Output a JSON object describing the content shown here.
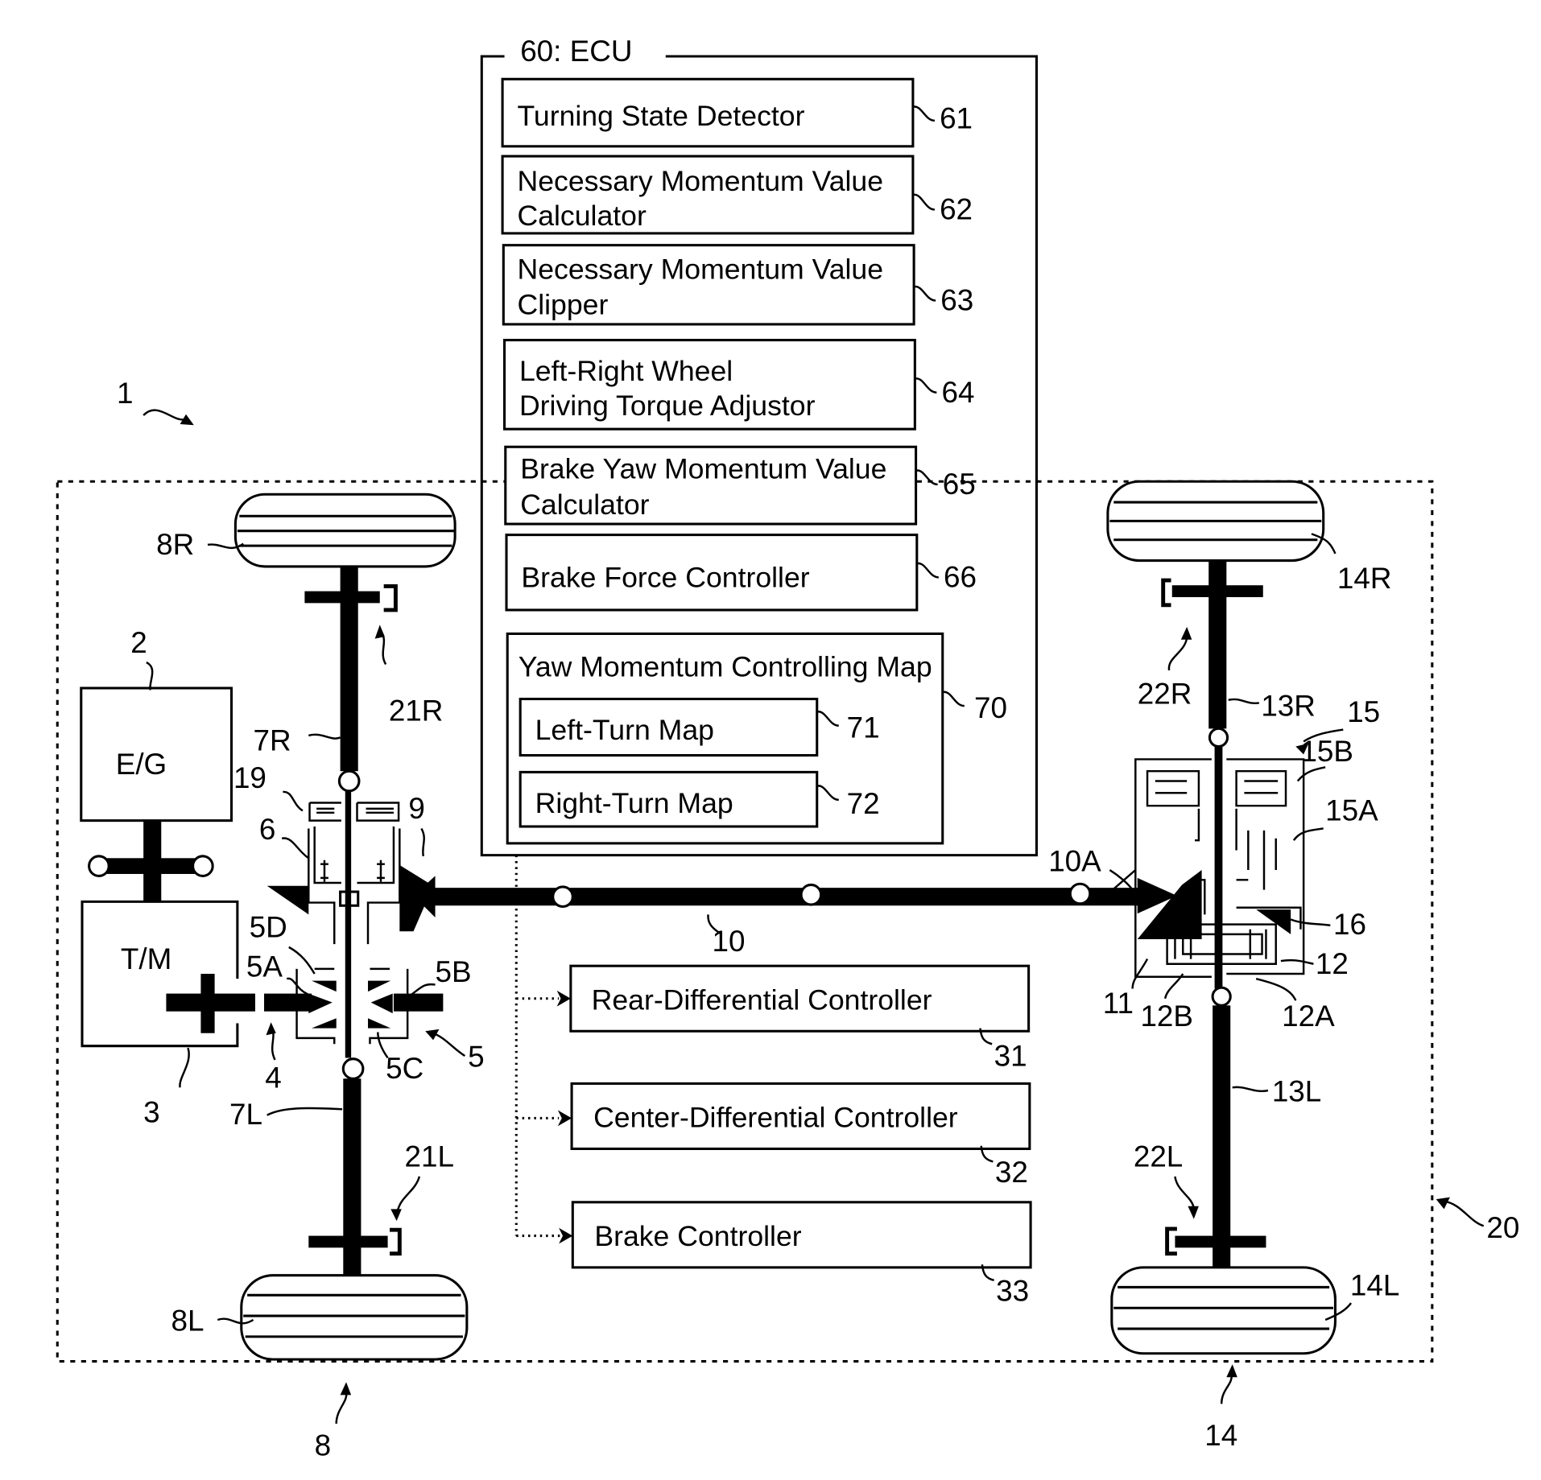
{
  "figure": {
    "system_label": "1",
    "vehicle_frame_label": "20"
  },
  "ecu": {
    "title": "60: ECU",
    "modules": [
      {
        "ref": "61",
        "lines": [
          "Turning State Detector"
        ]
      },
      {
        "ref": "62",
        "lines": [
          "Necessary Momentum Value",
          "Calculator"
        ]
      },
      {
        "ref": "63",
        "lines": [
          "Necessary Momentum Value",
          "Clipper"
        ]
      },
      {
        "ref": "64",
        "lines": [
          "Left-Right Wheel",
          "Driving Torque Adjustor"
        ]
      },
      {
        "ref": "65",
        "lines": [
          "Brake Yaw Momentum Value",
          "Calculator"
        ]
      },
      {
        "ref": "66",
        "lines": [
          "Brake Force Controller"
        ]
      }
    ],
    "map": {
      "ref": "70",
      "title": "Yaw Momentum Controlling Map",
      "submaps": [
        {
          "ref": "71",
          "label": "Left-Turn Map"
        },
        {
          "ref": "72",
          "label": "Right-Turn Map"
        }
      ]
    }
  },
  "controllers": [
    {
      "ref": "31",
      "label": "Rear-Differential Controller"
    },
    {
      "ref": "32",
      "label": "Center-Differential Controller"
    },
    {
      "ref": "33",
      "label": "Brake Controller"
    }
  ],
  "drivetrain": {
    "engine": {
      "ref": "2",
      "label": "E/G"
    },
    "transmission": {
      "ref": "3",
      "label": "T/M"
    },
    "labels": {
      "output_shaft": "4",
      "front_diff": "5",
      "front_diff_5A": "5A",
      "front_diff_5B": "5B",
      "front_diff_5C": "5C",
      "front_diff_5D": "5D",
      "gear_6": "6",
      "axle_7R": "7R",
      "axle_7L": "7L",
      "front_wheels": "8",
      "wheel_8R": "8R",
      "wheel_8L": "8L",
      "transfer_9": "9",
      "propshaft": "10",
      "propshaft_10A": "10A",
      "rear_gear_11": "11",
      "rear_diff_12": "12",
      "rear_diff_12A": "12A",
      "rear_diff_12B": "12B",
      "axle_13R": "13R",
      "axle_13L": "13L",
      "rear_wheels": "14",
      "wheel_14R": "14R",
      "wheel_14L": "14L",
      "rear_unit_15": "15",
      "rear_unit_15A": "15A",
      "rear_unit_15B": "15B",
      "gear_16": "16",
      "center_clutch_19": "19",
      "brake_21R": "21R",
      "brake_21L": "21L",
      "brake_22R": "22R",
      "brake_22L": "22L"
    }
  }
}
